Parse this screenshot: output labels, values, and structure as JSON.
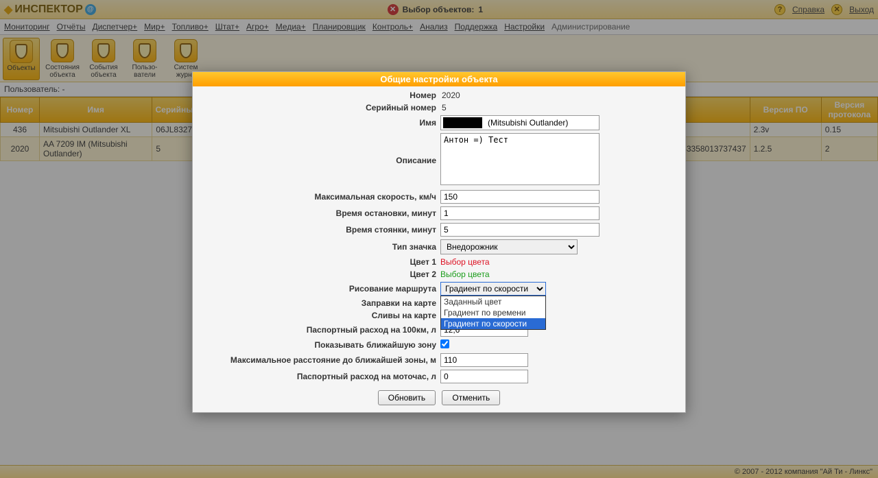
{
  "header": {
    "brand": "ИНСПЕКТОР",
    "center_label": "Выбор объектов:",
    "center_count": "1",
    "help": "Справка",
    "exit": "Выход"
  },
  "menu": [
    "Мониторинг",
    "Отчёты",
    "Диспетчер+",
    "Мир+",
    "Топливо+",
    "Штат+",
    "Агро+",
    "Медиа+",
    "Планировщик",
    "Контроль+",
    "Анализ",
    "Поддержка",
    "Настройки",
    "Администрирование"
  ],
  "tools": [
    {
      "label": "Объекты"
    },
    {
      "label": "Состояния объекта"
    },
    {
      "label": "События объекта"
    },
    {
      "label": "Пользо-ватели"
    },
    {
      "label": "Систем журна"
    }
  ],
  "userbar": "Пользователь: -",
  "table": {
    "headers": [
      "Номер",
      "Имя",
      "Серийный н",
      "",
      "",
      "",
      "",
      "Версия ПО",
      "Версия протокола"
    ],
    "rows": [
      [
        "436",
        "Mitsubishi Outlander XL",
        "06JL8327",
        "",
        "",
        "",
        "",
        "2.3v",
        "0.15"
      ],
      [
        "2020",
        "AA 7209 IM (Mitsubishi Outlander)",
        "5",
        "",
        "",
        "",
        "500,353358013737437",
        "1.2.5",
        "2"
      ]
    ]
  },
  "dialog": {
    "title": "Общие настройки объекта",
    "labels": {
      "number": "Номер",
      "serial": "Серийный номер",
      "name": "Имя",
      "desc": "Описание",
      "maxspeed": "Максимальная скорость, км/ч",
      "stoptime": "Время остановки, минут",
      "parktime": "Время стоянки, минут",
      "icontype": "Тип значка",
      "color1": "Цвет 1",
      "color2": "Цвет 2",
      "route": "Рисование маршрута",
      "fuel_in": "Заправки на карте",
      "fuel_out": "Сливы на карте",
      "consumption100": "Паспортный расход на 100км, л",
      "showzone": "Показывать ближайшую зону",
      "maxdist": "Максимальное расстояние до ближайшей зоны, м",
      "consumption_h": "Паспортный расход на моточас, л"
    },
    "values": {
      "number": "2020",
      "serial": "5",
      "name_suffix": "(Mitsubishi Outlander)",
      "desc": "Антон =) Тест",
      "maxspeed": "150",
      "stoptime": "1",
      "parktime": "5",
      "icontype": "Внедорожник",
      "color_pick": "Выбор цвета",
      "route": "Градиент по скорости",
      "consumption100": "12,6",
      "maxdist": "110",
      "consumption_h": "0"
    },
    "route_options": [
      "Заданный цвет",
      "Градиент по времени",
      "Градиент по скорости"
    ],
    "buttons": {
      "update": "Обновить",
      "cancel": "Отменить"
    }
  },
  "footer": "© 2007 - 2012 компания \"Ай Ти - Линкс\""
}
